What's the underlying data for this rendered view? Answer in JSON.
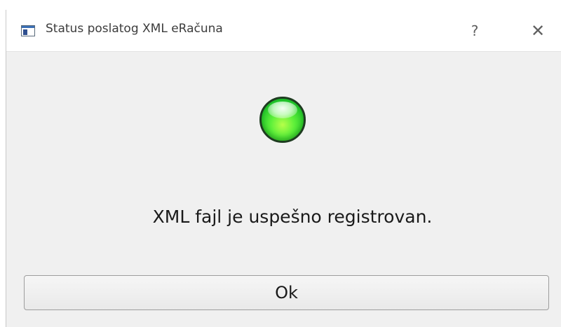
{
  "window": {
    "title": "Status poslatog XML eRačuna",
    "help_glyph": "?",
    "close_glyph": "✕",
    "icon": "app-window-icon"
  },
  "status": {
    "icon": "green-status-led-icon",
    "color": "#22c82b",
    "message": "XML fajl je uspešno registrovan."
  },
  "actions": {
    "ok_label": "Ok"
  }
}
